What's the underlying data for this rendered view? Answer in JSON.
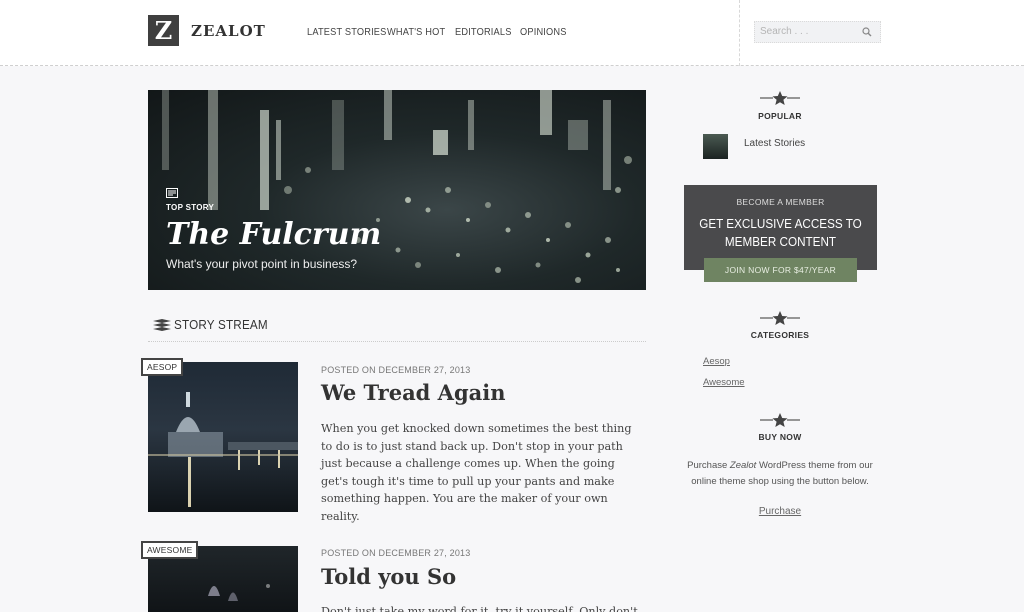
{
  "header": {
    "logo_letter": "Z",
    "site_name": "ZEALOT",
    "nav": [
      "LATEST STORIES",
      "WHAT'S HOT",
      "EDITORIALS",
      "OPINIONS"
    ],
    "search_placeholder": "Search . . ."
  },
  "hero": {
    "badge": "TOP STORY",
    "title": "The Fulcrum",
    "subtitle": "What's your pivot point in business?"
  },
  "stream": {
    "heading": "STORY STREAM",
    "posts": [
      {
        "tag": "AESOP",
        "meta": "POSTED ON DECEMBER 27, 2013",
        "title": "We Tread Again",
        "excerpt": "When you get knocked down sometimes the best thing to do is to just stand back up. Don't stop in your path just because a challenge comes up. When the going get's tough it's time to pull up your pants and make something happen. You are the maker of your own reality."
      },
      {
        "tag": "AWESOME",
        "meta": "POSTED ON DECEMBER 27, 2013",
        "title": "Told you So",
        "excerpt": "Don't just take my word for it, try it yourself. Only don't listen"
      }
    ]
  },
  "sidebar": {
    "popular_title": "POPULAR",
    "popular_link": "Latest Stories",
    "member_small": "BECOME A MEMBER",
    "member_big_1": "GET EXCLUSIVE ACCESS TO",
    "member_big_2": "MEMBER CONTENT",
    "join_button": "JOIN NOW FOR $47/YEAR",
    "categories_title": "CATEGORIES",
    "categories": [
      "Aesop",
      "Awesome"
    ],
    "buy_title": "BUY NOW",
    "buy_text_1": "Purchase ",
    "buy_text_em": "Zealot",
    "buy_text_2": " WordPress theme from our online theme shop using the button below.",
    "purchase_link": "Purchase"
  },
  "colors": {
    "accent_green": "#6f8462",
    "dark_box": "#4a4a4c",
    "text": "#333333"
  },
  "icons": [
    "search-icon",
    "newspaper-icon",
    "stack-icon",
    "star-divider-icon"
  ]
}
